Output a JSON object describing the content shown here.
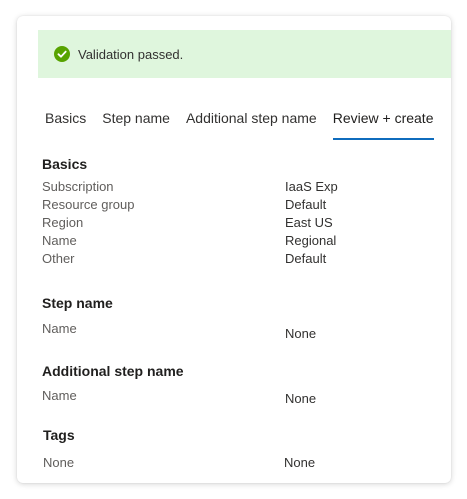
{
  "banner": {
    "icon": "check-circle-icon",
    "icon_color": "#57a300",
    "message": "Validation passed."
  },
  "tabs": [
    {
      "label": "Basics",
      "active": false
    },
    {
      "label": "Step name",
      "active": false
    },
    {
      "label": "Additional step name",
      "active": false
    },
    {
      "label": "Review + create",
      "active": true
    }
  ],
  "accent_color": "#0f6cbd",
  "basics": {
    "title": "Basics",
    "rows": [
      {
        "label": "Subscription",
        "value": "IaaS Exp"
      },
      {
        "label": "Resource group",
        "value": "Default"
      },
      {
        "label": "Region",
        "value": "East US"
      },
      {
        "label": "Name",
        "value": "Regional"
      },
      {
        "label": "Other",
        "value": "Default"
      }
    ]
  },
  "step_name": {
    "title": "Step name",
    "rows": [
      {
        "label": "Name",
        "value": "None"
      }
    ]
  },
  "additional_step_name": {
    "title": "Additional step name",
    "rows": [
      {
        "label": "Name",
        "value": "None"
      }
    ]
  },
  "tags": {
    "title": "Tags",
    "rows": [
      {
        "label": "None",
        "value": "None"
      }
    ]
  }
}
